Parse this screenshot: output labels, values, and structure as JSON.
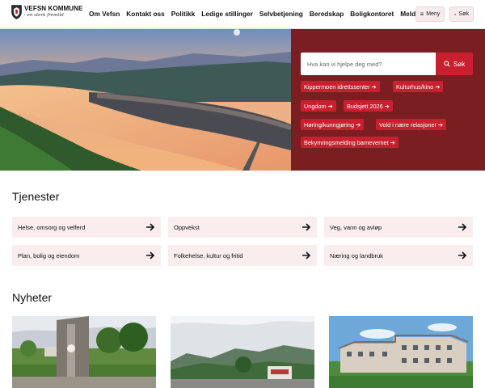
{
  "header": {
    "logo_name": "VEFSN KOMMUNE",
    "logo_motto": "- en sterk fremtid",
    "nav": [
      "Om Vefsn",
      "Kontakt oss",
      "Politikk",
      "Ledige stillinger",
      "Selvbetjening",
      "Beredskap",
      "Boligkontoret",
      "Melde feil"
    ],
    "menu_label": "Meny",
    "search_label": "Søk"
  },
  "hero": {
    "search_placeholder": "Hva kan vi hjelpe deg med?",
    "search_button": "Søk",
    "quick_links": [
      "Kippermoen idrettssenter",
      "Kulturhus/kino",
      "Ungdom",
      "Budsjett 2026",
      "Høring/kunngjøring",
      "Vold i nære relasjoner",
      "Bekymringsmelding barnevernet"
    ]
  },
  "services": {
    "title": "Tjenester",
    "items": [
      "Helse, omsorg og velferd",
      "Oppvekst",
      "Veg, vann og avløp",
      "Plan, bolig og eiendom",
      "Folkehelse, kultur og fritid",
      "Næring og landbruk"
    ]
  },
  "news": {
    "title": "Nyheter"
  },
  "colors": {
    "brand_red": "#c8202f",
    "panel_maroon": "#7a1e22",
    "card_bg": "#f9eded"
  }
}
